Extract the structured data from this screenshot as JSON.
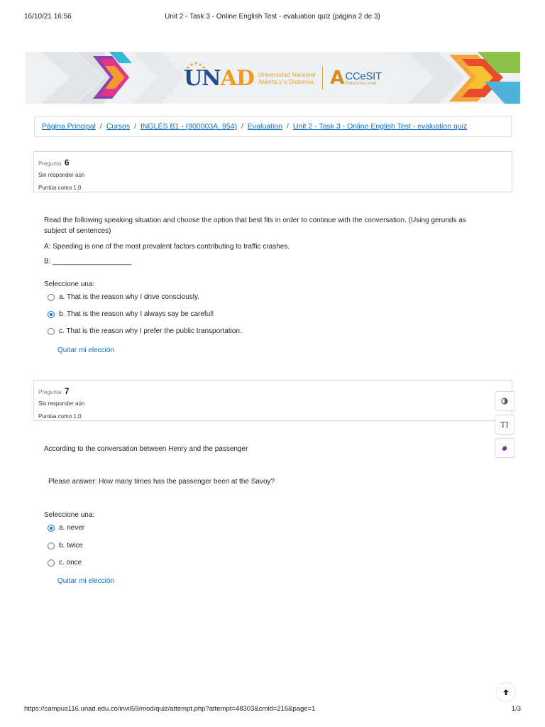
{
  "print_header": {
    "datetime": "16/10/21 16:56",
    "title": "Unit 2 - Task 3 - Online English Test - evaluation quiz (página 2 de 3)"
  },
  "banner": {
    "unad_prefix": "UN",
    "unad_suffix": "AD",
    "unad_line1": "Universidad Nacional",
    "unad_line2": "Abierta y a Distancia",
    "accesit_letter": "A",
    "accesit_word": "CCeSIT",
    "accesit_sub": "Plataforma unad"
  },
  "breadcrumb": {
    "items": [
      "Página Principal",
      "Cursos",
      "INGLÉS B1 - (900003A_954)",
      "Evaluation",
      "Unit 2 - Task 3 - Online English Test - evaluation quiz"
    ],
    "separator": "/"
  },
  "q6": {
    "label": "Pregunta",
    "number": "6",
    "state": "Sin responder aún",
    "grade": "Puntúa como 1,0",
    "text_line1": "Read the following speaking situation and choose the option that best fits in order to continue with the conversation. (Using gerunds as",
    "text_line2": "subject of sentences)",
    "dialog_a": "A: Speeding is one of the most prevalent factors contributing to traffic crashes.",
    "dialog_b": "B: ____________________",
    "prompt": "Seleccione una:",
    "options": [
      {
        "text": "a. That is the reason why I drive consciously.",
        "checked": false
      },
      {
        "text": "b. That is the reason why I always say be careful!",
        "checked": true
      },
      {
        "text": "c. That is the reason why I prefer the public transportation.",
        "checked": false
      }
    ],
    "clear": "Quitar mi elección"
  },
  "q7": {
    "label": "Pregunta",
    "number": "7",
    "state": "Sin responder aún",
    "grade": "Puntúa como 1,0",
    "text": "According to the conversation between Henry and the passenger",
    "sub_question": "Please answer: How many times has the passenger been at the Savoy?",
    "prompt": "Seleccione una:",
    "options": [
      {
        "text": "a. never",
        "checked": true
      },
      {
        "text": "b. twice",
        "checked": false
      },
      {
        "text": "c. once",
        "checked": false
      }
    ],
    "clear": "Quitar mi elección"
  },
  "side_buttons": {
    "text_size_label": "TI"
  },
  "print_footer": {
    "url": "https://campus116.unad.edu.co/invil59/mod/quiz/attempt.php?attempt=48303&cmid=216&page=1",
    "page": "1/3"
  },
  "colors": {
    "link": "#0f6cbf",
    "border": "#dee2e6",
    "unad_blue": "#1d4f8f",
    "unad_orange": "#f49a1a"
  }
}
